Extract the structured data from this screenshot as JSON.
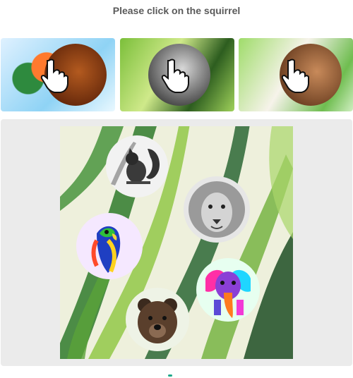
{
  "prompt": "Please click on the squirrel",
  "examples": [
    {
      "icon": "squirrel-example-icon"
    },
    {
      "icon": "squirrel-example-icon"
    },
    {
      "icon": "squirrel-example-icon"
    }
  ],
  "animals": [
    {
      "name": "squirrel",
      "icon": "squirrel-icon"
    },
    {
      "name": "lion",
      "icon": "lion-icon"
    },
    {
      "name": "parrot",
      "icon": "parrot-icon"
    },
    {
      "name": "elephant",
      "icon": "elephant-icon"
    },
    {
      "name": "bear",
      "icon": "bear-icon"
    }
  ],
  "colors": {
    "prompt": "#5a5a5a",
    "panel": "#ebebeb",
    "leaf_dark": "#1f5f2a",
    "leaf_light": "#8cc63f"
  },
  "footer": {
    "left_text": "",
    "indicator_color": "#1fa88a"
  }
}
